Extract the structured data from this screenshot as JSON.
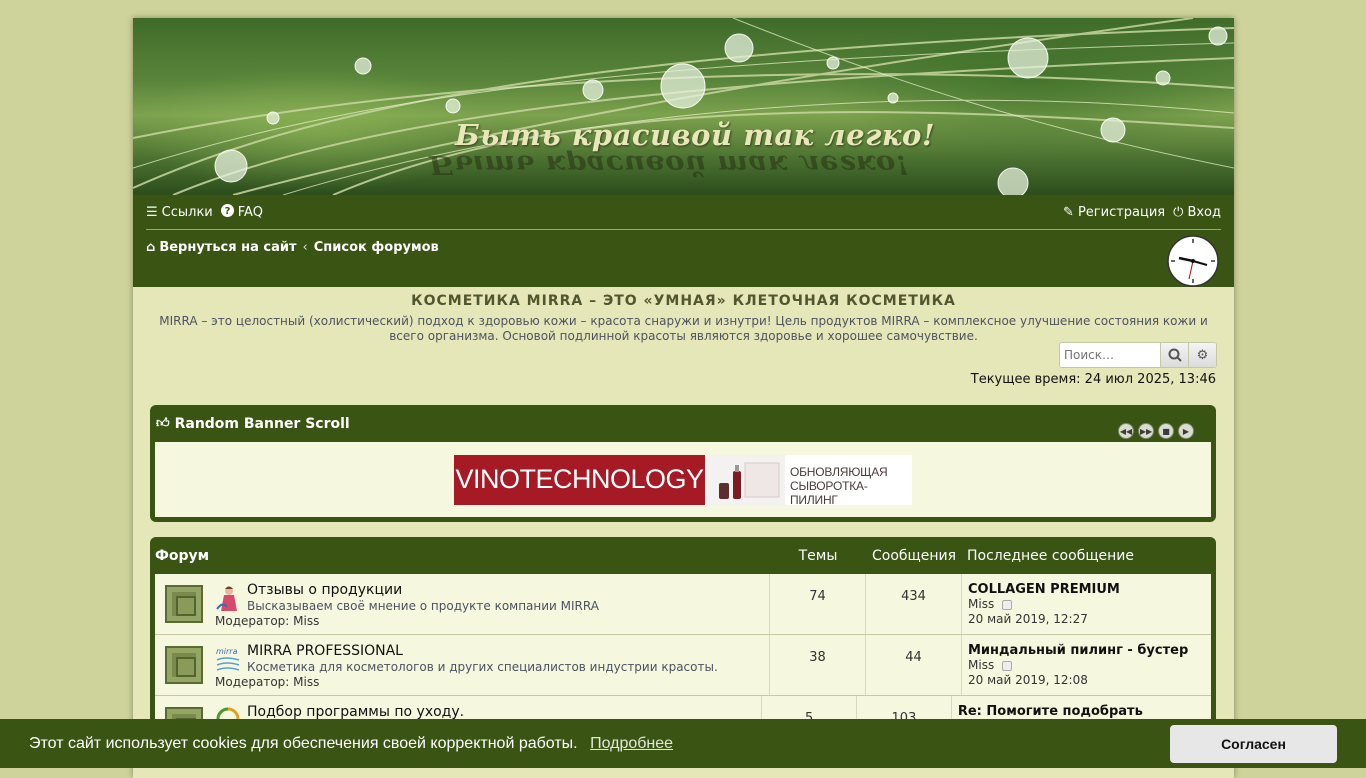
{
  "header": {
    "banner_title": "Быть красивой так легко!",
    "banner_reflection": "Быть красивой так легко!"
  },
  "navbar": {
    "links_label": "Ссылки",
    "faq_label": "FAQ",
    "register_label": "Регистрация",
    "login_label": "Вход",
    "breadcrumb_home": "Вернуться на сайт",
    "breadcrumb_forums": "Список форумов"
  },
  "site": {
    "title": "КОСМЕТИКА MIRRA – ЭТО «УМНАЯ» КЛЕТОЧНАЯ КОСМЕТИКА",
    "description": "MIRRA – это целостный (холистический) подход к здоровью кожи – красота снаружи и изнутри! Цель продуктов MIRRA – комплексное улучшение состояния кожи и всего организма. Основой подлинной красоты являются здоровье и хорошее самочувствие."
  },
  "search": {
    "placeholder": "Поиск…"
  },
  "current_time": "Текущее время: 24 июл 2025, 13:46",
  "banner_panel": {
    "title": "Random Banner Scroll",
    "ad_brand": "VINOTECHNOLOGY",
    "ad_line1": "ОБНОВЛЯЮЩАЯ",
    "ad_line2": "СЫВОРОТКА-ПИЛИНГ"
  },
  "forum_table": {
    "col_forum": "Форум",
    "col_topics": "Темы",
    "col_posts": "Сообщения",
    "col_last": "Последнее сообщение",
    "rows": [
      {
        "title": "Отзывы о продукции",
        "desc": "Высказываем своё мнение о продукте компании MIRRA",
        "mod_label": "Модератор:",
        "mod_name": "Miss",
        "topics": "74",
        "posts": "434",
        "last_title": "COLLAGEN PREMIUM",
        "last_author": "Miss",
        "last_date": "20 май 2019, 12:27"
      },
      {
        "title": "MIRRA PROFESSIONAL",
        "desc": "Косметика для косметологов и других специалистов индустрии красоты.",
        "mod_label": "Модератор:",
        "mod_name": "Miss",
        "topics": "38",
        "posts": "44",
        "last_title": "Миндальный пилинг - бустер",
        "last_author": "Miss",
        "last_date": "20 май 2019, 12:08"
      },
      {
        "title": "Подбор программы по уходу.",
        "desc": "",
        "mod_label": "",
        "mod_name": "",
        "topics": "5",
        "posts": "103",
        "last_title": "Re: Помогите подобрать програ...",
        "last_author": "",
        "last_date": ""
      }
    ]
  },
  "cookie": {
    "text": "Этот сайт использует cookies для обеспечения своей корректной работы.",
    "link": "Подробнее",
    "button": "Согласен"
  },
  "colors": {
    "page_bg": "#cdd39a",
    "content_bg": "#e6e7b8",
    "nav_green": "#3a5414",
    "row_bg": "#f5f8de",
    "ad_red": "#a51a25"
  }
}
